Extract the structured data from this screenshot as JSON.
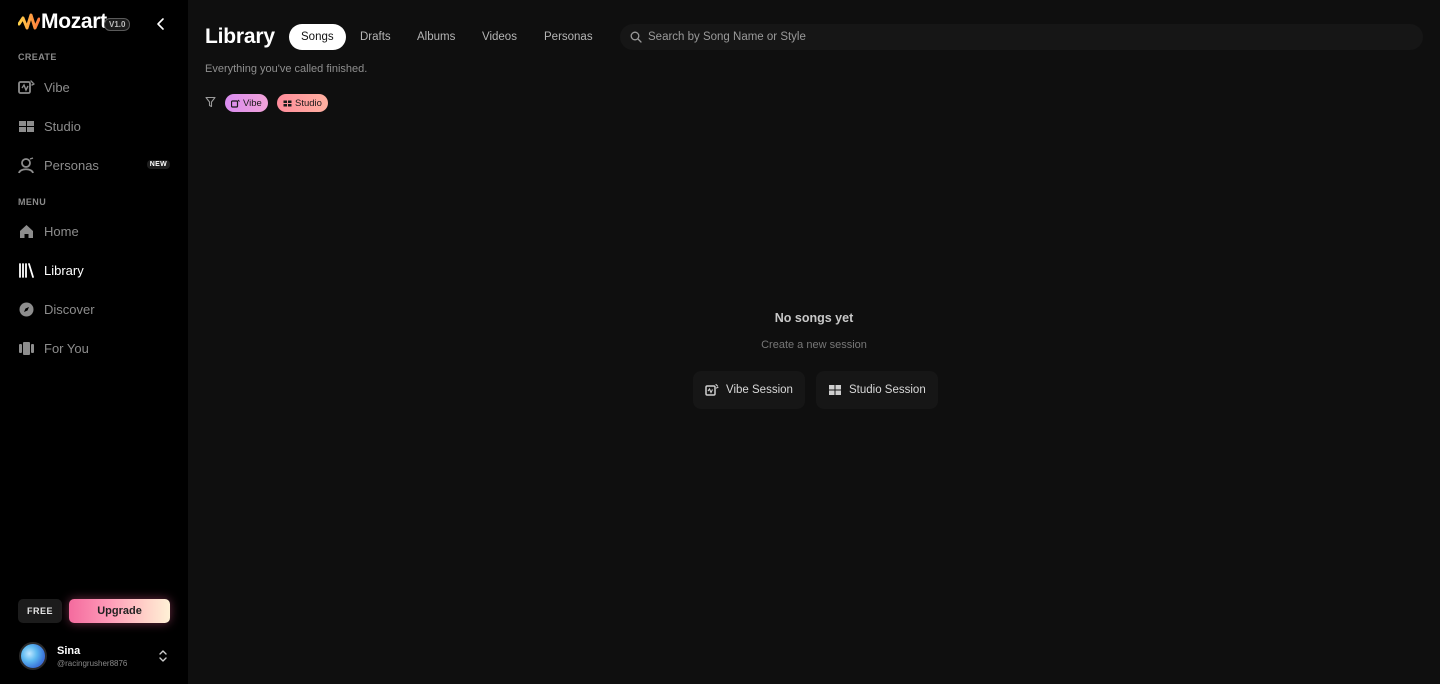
{
  "app": {
    "name": "Mozart",
    "version": "V1.0"
  },
  "sidebar": {
    "create_label": "CREATE",
    "create_items": [
      {
        "label": "Vibe",
        "icon": "vibe-icon"
      },
      {
        "label": "Studio",
        "icon": "studio-icon"
      },
      {
        "label": "Personas",
        "icon": "personas-icon",
        "badge": "NEW"
      }
    ],
    "menu_label": "MENU",
    "menu_items": [
      {
        "label": "Home",
        "icon": "home-icon"
      },
      {
        "label": "Library",
        "icon": "library-icon",
        "active": true
      },
      {
        "label": "Discover",
        "icon": "discover-icon"
      },
      {
        "label": "For You",
        "icon": "for-you-icon"
      }
    ],
    "plan": "FREE",
    "upgrade_label": "Upgrade",
    "user": {
      "name": "Sina",
      "handle": "@racingrusher8876"
    }
  },
  "main": {
    "title": "Library",
    "tabs": [
      "Songs",
      "Drafts",
      "Albums",
      "Videos",
      "Personas"
    ],
    "active_tab": "Songs",
    "search_placeholder": "Search by Song Name or Style",
    "subtitle": "Everything you've called finished.",
    "filters": [
      {
        "label": "Vibe",
        "icon": "vibe-icon"
      },
      {
        "label": "Studio",
        "icon": "studio-icon"
      }
    ],
    "empty_state": {
      "title": "No songs yet",
      "subtitle": "Create a new session",
      "buttons": [
        {
          "label": "Vibe Session",
          "icon": "vibe-icon"
        },
        {
          "label": "Studio Session",
          "icon": "studio-icon"
        }
      ]
    }
  },
  "colors": {
    "sidebar_bg": "#000000",
    "main_bg": "#0f0f0f",
    "logo_accent": "#ffb347",
    "vibe_chip": "#d98cf0",
    "studio_chip": "#ff8c9b"
  }
}
